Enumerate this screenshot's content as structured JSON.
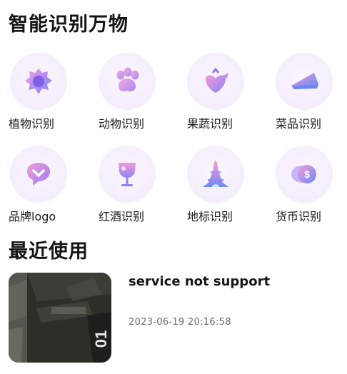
{
  "recognize_section": {
    "title": "智能识别万物",
    "items": [
      {
        "label": "植物识别",
        "icon": "plant-icon"
      },
      {
        "label": "动物识别",
        "icon": "animal-paw-icon"
      },
      {
        "label": "果蔬识别",
        "icon": "fruit-vegetable-icon"
      },
      {
        "label": "菜品识别",
        "icon": "dish-icon"
      },
      {
        "label": "品牌logo",
        "icon": "brand-logo-icon"
      },
      {
        "label": "红酒识别",
        "icon": "wine-glass-icon"
      },
      {
        "label": "地标识别",
        "icon": "landmark-tower-icon"
      },
      {
        "label": "货币识别",
        "icon": "currency-coin-icon"
      }
    ]
  },
  "recent_section": {
    "title": "最近使用",
    "items": [
      {
        "title": "service not support",
        "time": "2023-06-19 20:16:58",
        "thumbnail_text": "01"
      }
    ]
  },
  "colors": {
    "icon_purple": "#a77bf5",
    "icon_blue": "#6a8cf5",
    "icon_pink": "#f39ad8",
    "circle_bg": "#f4edfb"
  }
}
